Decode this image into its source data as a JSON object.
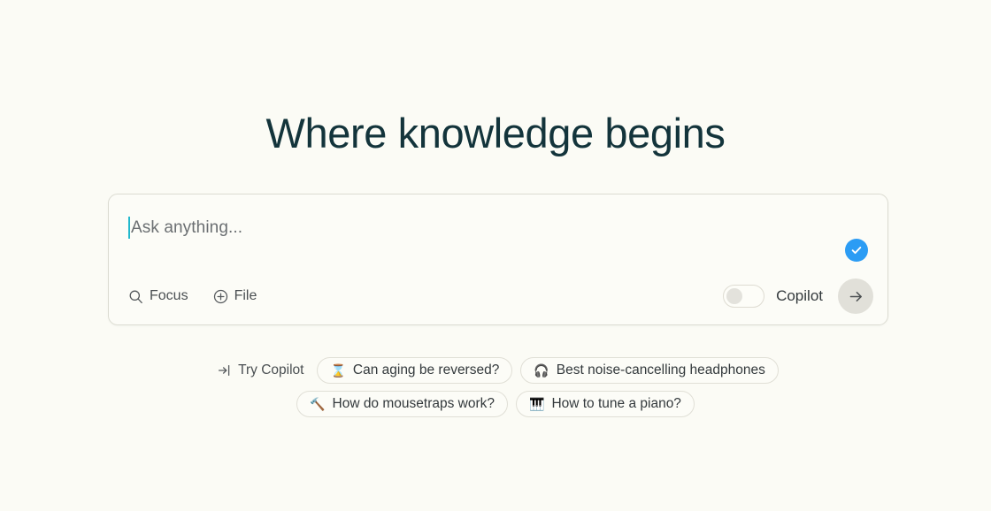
{
  "header": {
    "title": "Where knowledge begins"
  },
  "search": {
    "placeholder": "Ask anything...",
    "value": "",
    "caret_color": "#21b8cd",
    "verified_badge": {
      "icon": "check-icon",
      "color": "#2b9cf4"
    },
    "tools": [
      {
        "label": "Focus",
        "icon": "search-icon"
      },
      {
        "label": "File",
        "icon": "plus-circle-icon"
      }
    ],
    "copilot": {
      "label": "Copilot",
      "enabled": false
    },
    "submit": {
      "icon": "arrow-right-icon",
      "label": "Submit"
    }
  },
  "suggestions": {
    "try_copilot": {
      "label": "Try Copilot",
      "icon": "enter-arrow-icon"
    },
    "row1": [
      {
        "emoji": "⌛",
        "emoji_name": "hourglass-emoji",
        "label": "Can aging be reversed?"
      },
      {
        "emoji": "🎧",
        "emoji_name": "headphones-emoji",
        "label": "Best noise-cancelling headphones"
      }
    ],
    "row2": [
      {
        "emoji": "🔨",
        "emoji_name": "hammer-emoji",
        "label": "How do mousetraps work?"
      },
      {
        "emoji": "🎹",
        "emoji_name": "piano-emoji",
        "label": "How to tune a piano?"
      }
    ]
  },
  "theme": {
    "background": "#fbfbf5",
    "title_color": "#13343b",
    "accent": "#2b9cf4",
    "border": "#dcdcd2"
  }
}
